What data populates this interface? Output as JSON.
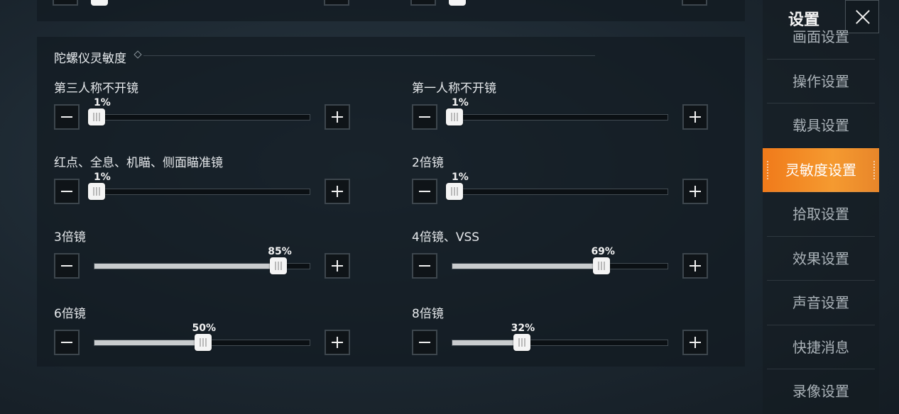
{
  "nav": {
    "title": "设置",
    "items": [
      {
        "label": "画面设置"
      },
      {
        "label": "操作设置"
      },
      {
        "label": "载具设置"
      },
      {
        "label": "灵敏度设置",
        "active": true
      },
      {
        "label": "拾取设置"
      },
      {
        "label": "效果设置"
      },
      {
        "label": "声音设置"
      },
      {
        "label": "快捷消息"
      },
      {
        "label": "录像设置"
      }
    ]
  },
  "section": {
    "title": "陀螺仪灵敏度",
    "sliders": [
      {
        "label": "第三人称不开镜",
        "value_text": "1%",
        "value": 1
      },
      {
        "label": "第一人称不开镜",
        "value_text": "1%",
        "value": 1
      },
      {
        "label": "红点、全息、机瞄、侧面瞄准镜",
        "value_text": "1%",
        "value": 1
      },
      {
        "label": "2倍镜",
        "value_text": "1%",
        "value": 1
      },
      {
        "label": "3倍镜",
        "value_text": "85%",
        "value": 85
      },
      {
        "label": "4倍镜、VSS",
        "value_text": "69%",
        "value": 69
      },
      {
        "label": "6倍镜",
        "value_text": "50%",
        "value": 50
      },
      {
        "label": "8倍镜",
        "value_text": "32%",
        "value": 32
      }
    ]
  },
  "colors": {
    "accent": "#f28a22",
    "panel": "#121a21"
  },
  "icons": {
    "minus": "minus-icon",
    "plus": "plus-icon",
    "close": "close-icon"
  }
}
